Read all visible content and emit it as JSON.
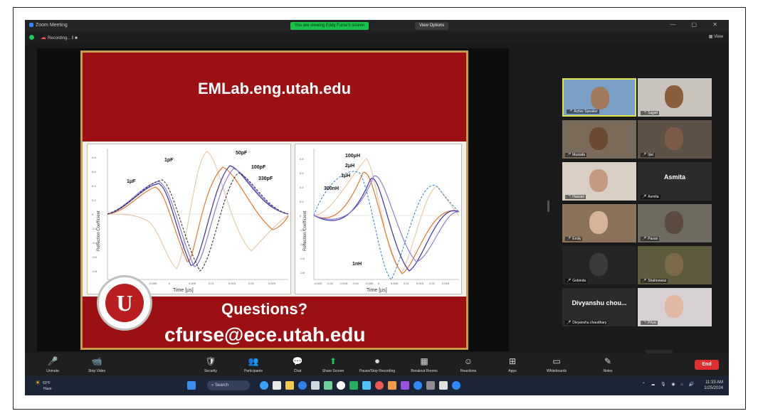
{
  "window": {
    "title": "Zoom Meeting",
    "banner": "You are viewing Eddy Furse's screen",
    "view_options": "View Options",
    "recording": "Recording...",
    "view": "View",
    "controls": "— ▢ ✕"
  },
  "slide": {
    "url": "EMLab.eng.utah.edu",
    "questions": "Questions?",
    "email": "cfurse@ece.utah.edu",
    "logo_letter": "U",
    "left_plot": {
      "ylabel": "Reflection Coefficient",
      "xlabel": "Time [μs]",
      "labels": [
        "1pF",
        "50pF",
        "100pF",
        "330pF",
        "1μF"
      ],
      "yticks": [
        "0.8",
        "0.6",
        "0.4",
        "0.2",
        "0",
        "-0.2",
        "-0.4",
        "-0.6",
        "-0.8"
      ],
      "xticks": [
        "-0.015",
        "-0.01",
        "-0.005",
        "0",
        "0.005",
        "0.01",
        "0.015",
        "0.02",
        "0.025"
      ]
    },
    "right_plot": {
      "ylabel": "Reflection Coefficient",
      "xlabel": "Time [μs]",
      "labels": [
        "100μH",
        "2μH",
        "1μH",
        "300nH",
        "1nH"
      ],
      "yticks": [
        "0.8",
        "0.6",
        "0.4",
        "0.2",
        "0",
        "-0.2",
        "-0.4",
        "-0.6",
        "-0.8"
      ],
      "xticks": [
        "-0.025",
        "-0.02",
        "-0.015",
        "-0.01",
        "-0.005",
        "0",
        "0.005",
        "0.01",
        "0.015",
        "0.02",
        "0.025"
      ]
    }
  },
  "gallery": [
    {
      "name": "Active Speaker",
      "active": true
    },
    {
      "name": "Sajjad"
    },
    {
      "name": "Mustafa"
    },
    {
      "name": "Ijlal"
    },
    {
      "name": "Hassan"
    },
    {
      "name": "Asmita",
      "big": "Asmita"
    },
    {
      "name": "Emily"
    },
    {
      "name": "Pavan"
    },
    {
      "name": "Gobinda"
    },
    {
      "name": "Shahnewaz"
    },
    {
      "name": "Divyanshu chaudhary",
      "big": "Divyanshu  chou..."
    },
    {
      "name": "Priya"
    }
  ],
  "toolbar": {
    "items": [
      {
        "icon": "🎤",
        "label": "Unmute"
      },
      {
        "icon": "📹",
        "label": "Stop Video"
      },
      {
        "icon": "🛡",
        "label": "Security"
      },
      {
        "icon": "👥",
        "label": "Participants"
      },
      {
        "icon": "💬",
        "label": "Chat"
      },
      {
        "icon": "⬆",
        "label": "Share Screen"
      },
      {
        "icon": "⏺",
        "label": "Pause/Stop Recording"
      },
      {
        "icon": "▦",
        "label": "Breakout Rooms"
      },
      {
        "icon": "☺",
        "label": "Reactions"
      },
      {
        "icon": "⊞",
        "label": "Apps"
      },
      {
        "icon": "▭",
        "label": "Whiteboards"
      },
      {
        "icon": "✎",
        "label": "Notes"
      }
    ],
    "end": "End"
  },
  "taskbar": {
    "temp": "63°F",
    "weather": "Haze",
    "search": "Search",
    "time": "11:33 AM",
    "date": "1/25/2024"
  }
}
